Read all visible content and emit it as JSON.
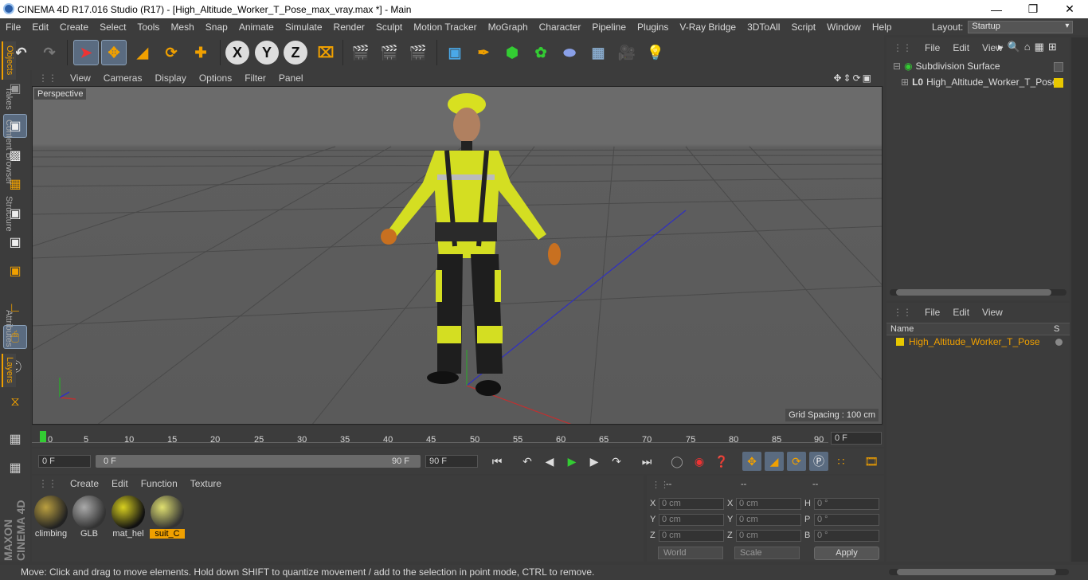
{
  "window": {
    "title": "CINEMA 4D R17.016 Studio (R17) - [High_Altitude_Worker_T_Pose_max_vray.max *] - Main",
    "controls": [
      "minimize",
      "restore",
      "close"
    ]
  },
  "menubar": {
    "items": [
      "File",
      "Edit",
      "Create",
      "Select",
      "Tools",
      "Mesh",
      "Snap",
      "Animate",
      "Simulate",
      "Render",
      "Sculpt",
      "Motion Tracker",
      "MoGraph",
      "Character",
      "Pipeline",
      "Plugins",
      "V-Ray Bridge",
      "3DToAll",
      "Script",
      "Window",
      "Help"
    ],
    "layout_label": "Layout:",
    "layout_value": "Startup"
  },
  "toolbar": {
    "axis_buttons": [
      "X",
      "Y",
      "Z"
    ]
  },
  "viewport": {
    "menu": [
      "View",
      "Cameras",
      "Display",
      "Options",
      "Filter",
      "Panel"
    ],
    "camera_label": "Perspective",
    "grid_spacing": "Grid Spacing : 100 cm"
  },
  "timeline": {
    "ticks": [
      "0",
      "5",
      "10",
      "15",
      "20",
      "25",
      "30",
      "35",
      "40",
      "45",
      "50",
      "55",
      "60",
      "65",
      "70",
      "75",
      "80",
      "85",
      "90"
    ],
    "current_frame": "0 F",
    "start_field": "0 F",
    "range_start": "0 F",
    "range_end": "90 F",
    "end_field": "90 F"
  },
  "materials": {
    "menu": [
      "Create",
      "Edit",
      "Function",
      "Texture"
    ],
    "items": [
      {
        "name": "climbing",
        "selected": false
      },
      {
        "name": "GLB",
        "selected": false
      },
      {
        "name": "mat_hel",
        "selected": false
      },
      {
        "name": "suit_C",
        "selected": true
      }
    ]
  },
  "coordinates": {
    "headers": [
      "--",
      "--",
      "--"
    ],
    "rows": [
      {
        "a_label": "X",
        "a_val": "0 cm",
        "b_label": "X",
        "b_val": "0 cm",
        "c_label": "H",
        "c_val": "0 °"
      },
      {
        "a_label": "Y",
        "a_val": "0 cm",
        "b_label": "Y",
        "b_val": "0 cm",
        "c_label": "P",
        "c_val": "0 °"
      },
      {
        "a_label": "Z",
        "a_val": "0 cm",
        "b_label": "Z",
        "b_val": "0 cm",
        "c_label": "B",
        "c_val": "0 °"
      }
    ],
    "mode_dropdown": "World",
    "type_dropdown": "Scale",
    "apply_label": "Apply"
  },
  "objects_panel": {
    "menu": [
      "File",
      "Edit",
      "View"
    ],
    "items": [
      {
        "name": "Subdivision Surface",
        "indent": 0
      },
      {
        "name": "High_Altitude_Worker_T_Pose",
        "indent": 1
      }
    ]
  },
  "layers_panel": {
    "menu": [
      "File",
      "Edit",
      "View"
    ],
    "columns": [
      "Name",
      "S"
    ],
    "items": [
      {
        "name": "High_Altitude_Worker_T_Pose",
        "color": "#e8c800"
      }
    ]
  },
  "side_tabs": [
    "Objects",
    "Takes",
    "Content Browser",
    "Structure",
    "Attributes",
    "Layers"
  ],
  "status": "Move: Click and drag to move elements. Hold down SHIFT to quantize movement / add to the selection in point mode, CTRL to remove.",
  "branding": "MAXON CINEMA 4D"
}
